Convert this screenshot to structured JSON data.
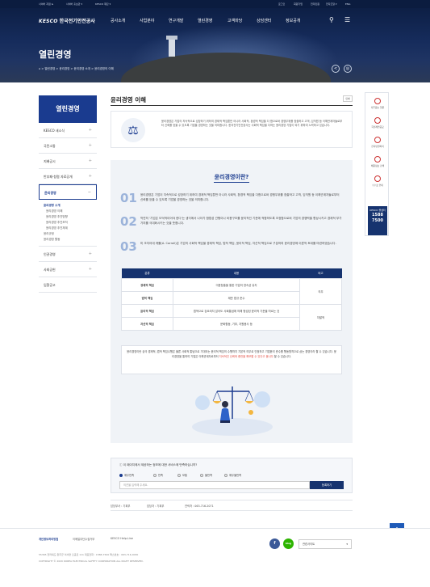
{
  "topbar": {
    "left_links": [
      "사이버 지점 &",
      "사이버 홍보관 ▾",
      "KESCO 재단 ▾"
    ],
    "right_links": [
      "로그인",
      "회원가입",
      "전자민원",
      "전자조달 ▾",
      "ENG"
    ]
  },
  "header": {
    "logo_brand": "KESCO",
    "logo_text": "한국전기안전공사",
    "nav": [
      "공사소개",
      "사업분야",
      "연구개발",
      "열린경영",
      "고객마당",
      "상담센터",
      "정보공개"
    ],
    "page_title": "열린경영",
    "breadcrumb": [
      "열린경영",
      "윤리경영",
      "윤리경영 소개",
      "윤리경영의 이해"
    ]
  },
  "sidebar": {
    "title": "열린경영",
    "items": [
      {
        "label": "KESCO 새소식"
      },
      {
        "label": "국민소통"
      },
      {
        "label": "지배공시"
      },
      {
        "label": "반부패·청렴 자료공개"
      },
      {
        "label": "윤리경영"
      }
    ],
    "sub_current": "윤리경영 소개",
    "sub_links": [
      "윤리경영 이해",
      "윤리경영 추진방향",
      "윤리경영 추진조직",
      "윤리경영 추진체계"
    ],
    "sub_more": [
      "윤리규정",
      "윤리경영 활동"
    ],
    "items_after": [
      {
        "label": "인권경영"
      },
      {
        "label": "사회공헌"
      },
      {
        "label": "입찰공고"
      }
    ]
  },
  "main": {
    "title": "윤리경영 이해",
    "print_label": "인쇄",
    "intro_text": "윤리경영은 기업의 지속적으로 성장하기 위하여 경제적 책임뿐만 아니라 사회적, 환경적 책임을 다 함으로써 경쟁우위를 창출하고 고객, 임직원 등 이해관계자들로부터 신뢰를 얻을 수 있도록 기업을 경영하는 것을 의미합니다. 한국전기안전공사는 사회적 책임을 다하는 윤리경영 기업이 되기 위하여 노력하고 있습니다.",
    "panel_title": "윤리경영이란?",
    "points": [
      {
        "num": "01",
        "text": "윤리경영은 기업이 지속적으로 성장하기 위하여 경제적 책임뿐만 아니라 사회적, 환경적 책임을 다함으로써 경쟁우위를 창출하고 고객, 임직원 등 이해관계자들로부터 신뢰를 얻을 수 있도록 기업을 경영하는 것을 의미합니다."
      },
      {
        "num": "02",
        "text": "막연히 '기업은 도덕적이어야 한다'는 생각에서 나아가 합법성 관행이나 비용구조를 윤리적인 기준에 적합하도록 조정함으로써 기업의 경쟁력을 향상시키고 경제적 부가가치를 극대화시키는 것을 뜻합니다."
      },
      {
        "num": "03",
        "text": "미 조지아대 캐롤(A. Carroll)은 기업의 사회적 책임을 경제적 책임, 법적 책임, 윤리적 책임, 자선적 책임으로 구분하여 윤리경영에 이론적 토대를 마련하였습니다."
      }
    ],
    "table": {
      "headers": [
        "분류",
        "내용",
        "비고"
      ],
      "rows": [
        {
          "label": "경제적 책임",
          "content": "이윤창출을 통한 기업의 영속성 유지",
          "note": "의무"
        },
        {
          "label": "법적 책임",
          "content": "제반 법규 준수",
          "note": ""
        },
        {
          "label": "윤리적 책임",
          "content": "법적으로 강요되지 않아도 사회통념에 의해 형성된 윤리적 기준을 따르는 것",
          "note": "자발적"
        },
        {
          "label": "자선적 책임",
          "content": "문화활동, 기부, 자원봉사 등",
          "note": ""
        }
      ]
    },
    "note_text": "윤리경영이란 궁극 경제적, 법적 책임수행은 물론 사회적 통념으로 기대되는 윤리적 책임의 수행까지 기본적 의무로 인정하고 기업윤리 준수를 행동원칙으로 삼는 경영이라 할 수 있습니다. 윤리경영을 통하여 기업은 이해관계자로부터",
    "note_highlight": "지속적인 신뢰와 충만을 확보할 수 있다고 봅니다",
    "note_end": "할 수 있습니다."
  },
  "survey": {
    "question": "이 페이지에서 제공하는 정보에 대한 서비스에 만족하십니까?",
    "options": [
      "매우만족",
      "만족",
      "보통",
      "불만족",
      "매우불만족"
    ],
    "selected": "매우만족",
    "placeholder": "의견을 입력해 주세요.",
    "submit_label": "등록하기"
  },
  "manager": {
    "dept": "담당부서 : 기획부",
    "person": "담당자 : 기획부",
    "phone": "연락처 : 063-716-2071"
  },
  "quick_menu": {
    "items": [
      "자주묻는 질문",
      "국민제안공모",
      "전자민원처리",
      "채용정보 검색",
      "수수료 안내"
    ],
    "call_label": "KESCO 콜센터",
    "call_number": "1588 7500"
  },
  "footer": {
    "links": [
      "개인정보처리방침",
      "이메일무단수집거부",
      "KESCO Help-Line"
    ],
    "address": "55365 전라북도 완주군 이서면 오공로 111  대표전화 : 1588-7500  팩스번호 : 063-716-0030",
    "copyright": "COPYRIGHT © 2020 KOREA ELECTRICAL SAFETY CORPORATION ALL RIGHT RESERVED.",
    "family_site": "관련사이트"
  }
}
